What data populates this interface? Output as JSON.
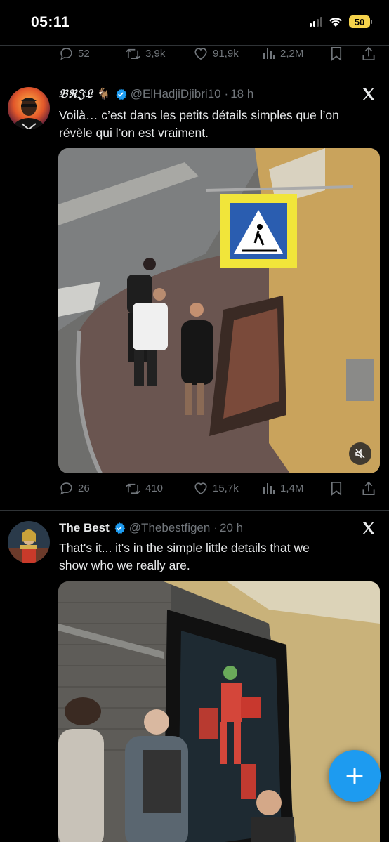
{
  "status_bar": {
    "time": "05:11",
    "battery": "50"
  },
  "prev_tweet": {
    "replies": "52",
    "reposts": "3,9k",
    "likes": "91,9k",
    "views": "2,2M"
  },
  "tweets": [
    {
      "display_name": "𝔅ℜ𝔍𝔏",
      "emoji": "🐐",
      "verified": true,
      "handle": "@ElHadjiDjibri10",
      "time": "18 h",
      "separator": "·",
      "text_line1": "Voilà… c’est dans les petits détails simples que l’on",
      "text_line2": "révèle qui l’on est vraiment.",
      "replies": "26",
      "reposts": "410",
      "likes": "15,7k",
      "views": "1,4M"
    },
    {
      "display_name": "The Best",
      "verified": true,
      "handle": "@Thebestfigen",
      "time": "20 h",
      "separator": "·",
      "text_line1": "That's it... it's in the simple little details that we",
      "text_line2": "show who we really are."
    }
  ],
  "colors": {
    "accent": "#1d9bf0",
    "muted": "#71767b",
    "text": "#e7e9ea",
    "background": "#000000",
    "battery": "#f5d24b"
  },
  "icons": [
    "reply-icon",
    "repost-icon",
    "like-icon",
    "views-icon",
    "bookmark-icon",
    "share-icon",
    "x-logo-icon",
    "verified-icon",
    "mute-icon",
    "compose-plus-icon",
    "wifi-icon",
    "signal-icon"
  ]
}
